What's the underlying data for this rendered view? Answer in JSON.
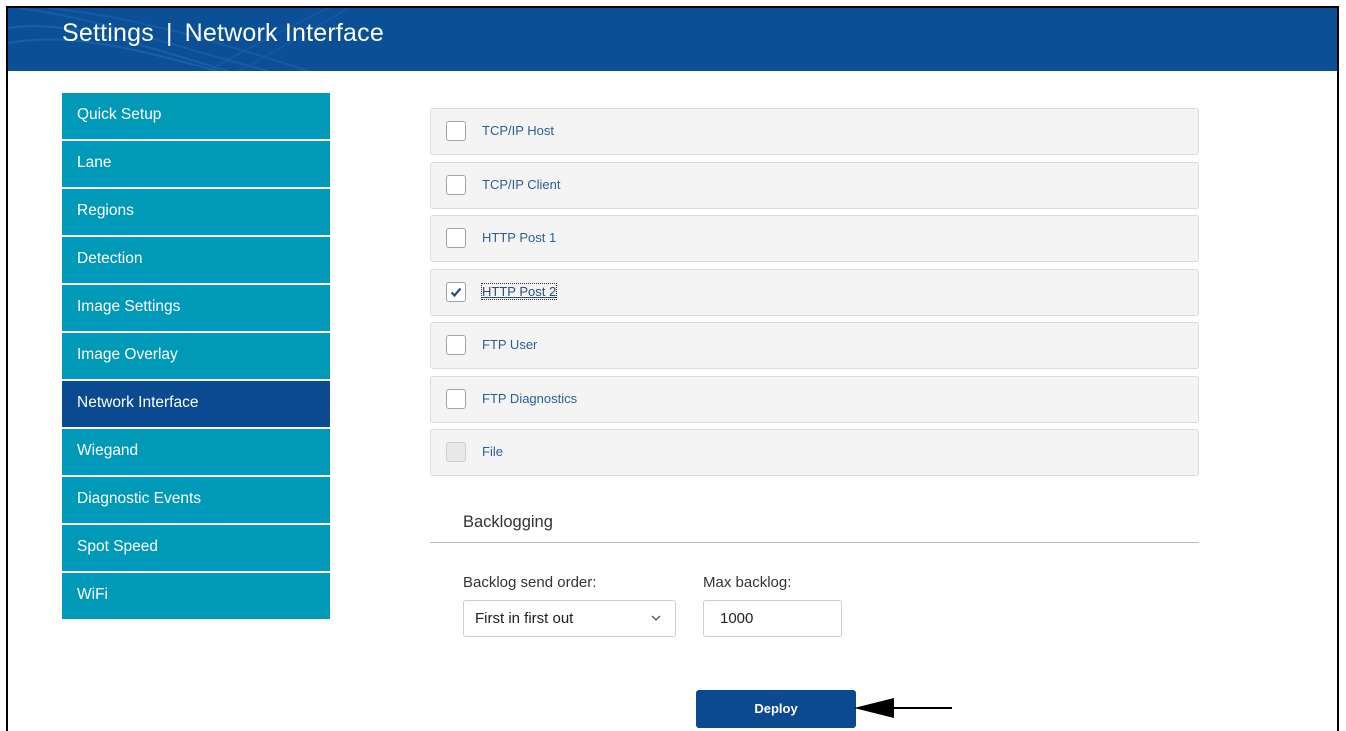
{
  "header": {
    "title_left": "Settings",
    "separator": "|",
    "title_right": "Network Interface"
  },
  "sidebar": {
    "items": [
      {
        "label": "Quick Setup",
        "active": false
      },
      {
        "label": "Lane",
        "active": false
      },
      {
        "label": "Regions",
        "active": false
      },
      {
        "label": "Detection",
        "active": false
      },
      {
        "label": "Image Settings",
        "active": false
      },
      {
        "label": "Image Overlay",
        "active": false
      },
      {
        "label": "Network Interface",
        "active": true
      },
      {
        "label": "Wiegand",
        "active": false
      },
      {
        "label": "Diagnostic Events",
        "active": false
      },
      {
        "label": "Spot Speed",
        "active": false
      },
      {
        "label": "WiFi",
        "active": false
      }
    ]
  },
  "interfaces": {
    "items": [
      {
        "label": "TCP/IP Host",
        "checked": false,
        "disabled": false
      },
      {
        "label": "TCP/IP Client",
        "checked": false,
        "disabled": false
      },
      {
        "label": "HTTP Post 1",
        "checked": false,
        "disabled": false
      },
      {
        "label": "HTTP Post 2",
        "checked": true,
        "disabled": false
      },
      {
        "label": "FTP User",
        "checked": false,
        "disabled": false
      },
      {
        "label": "FTP Diagnostics",
        "checked": false,
        "disabled": false
      },
      {
        "label": "File",
        "checked": false,
        "disabled": true
      }
    ]
  },
  "backlogging": {
    "title": "Backlogging",
    "send_order_label": "Backlog send order:",
    "send_order_value": "First in first out",
    "max_backlog_label": "Max backlog:",
    "max_backlog_value": "1000"
  },
  "actions": {
    "deploy_label": "Deploy"
  },
  "colors": {
    "header_bg": "#0b4f97",
    "sidebar_item": "#0099b8",
    "sidebar_active": "#0b4990",
    "deploy_bg": "#0b4990"
  }
}
